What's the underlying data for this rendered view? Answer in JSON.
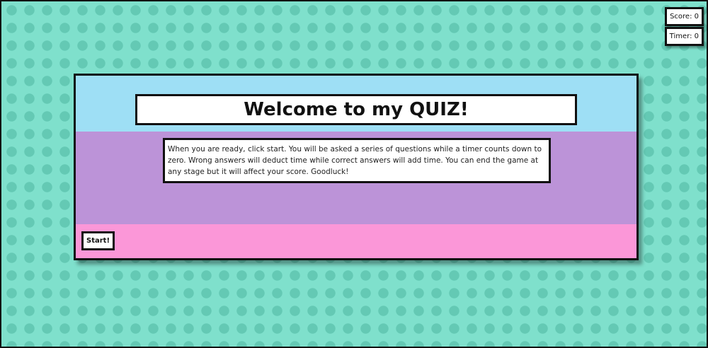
{
  "hud": {
    "score_text": "Score: 0",
    "timer_text": "Timer: 0"
  },
  "quiz": {
    "title": "Welcome to my QUIZ!",
    "intro": "When you are ready, click start. You will be asked a series of questions while a timer counts down to zero. Wrong answers will deduct time while correct answers will add time. You can end the game at any stage but it will affect your score. Goodluck!",
    "start_label": "Start!"
  },
  "colors": {
    "background": "#7fe0cc",
    "dots": "#64c9b4",
    "header": "#9edff5",
    "body": "#bc93d8",
    "footer": "#fb97d8",
    "border": "#111111"
  }
}
